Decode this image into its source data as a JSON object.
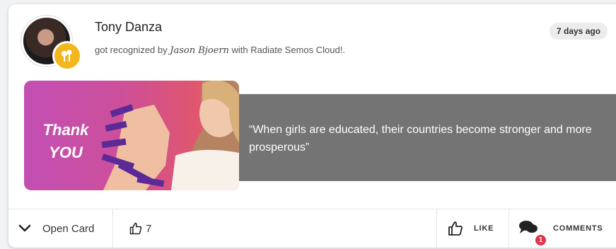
{
  "post": {
    "user_name": "Tony Danza",
    "recognition_prefix": "got recognized by",
    "recognizer": "Jason Bjoern",
    "recognition_suffix": "with Radiate Semos Cloud!.",
    "time_ago": "7 days ago"
  },
  "card": {
    "thank_line1": "Thank",
    "thank_line2": "YOU",
    "quote": "“When girls are educated, their countries become stronger and more prosperous”"
  },
  "footer": {
    "open_card_label": "Open Card",
    "likes_count": "7",
    "like_label": "LIKE",
    "comments_label": "COMMENTS",
    "comments_count": "1"
  },
  "icons": {
    "badge": "award-badge-icon",
    "open_card": "chevron-down-icon",
    "likes": "thumbs-up-icon",
    "like": "thumbs-up-icon",
    "comments": "comments-icon"
  },
  "colors": {
    "badge": "#f1b71c",
    "quote_bg": "#747474",
    "comment_count_bg": "#e0334c"
  }
}
